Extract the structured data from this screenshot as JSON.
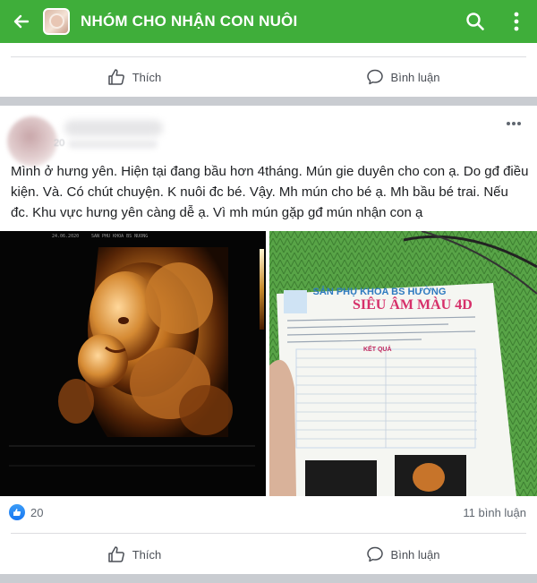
{
  "topbar": {
    "title": "NHÓM CHO NHẬN CON NUÔI",
    "back_icon": "arrow-left-icon",
    "search_icon": "search-icon",
    "more_icon": "vertical-ellipsis-icon",
    "color": "#3fae3a"
  },
  "prev_post": {
    "like_label": "Thích",
    "comment_label": "Bình luận"
  },
  "post": {
    "time_prefix": "20",
    "text": "Mình ở hưng yên. Hiện tại đang bầu hơn 4tháng. Mún gie duyên cho con ạ. Do gđ điều kiện. Và. Có chút chuyện. K nuôi đc bé. Vậy. Mh mún cho bé ạ. Mh bầu bé trai. Nếu đc. Khu vực hưng yên càng dễ ạ. Vì mh mún gặp gđ mún nhận con ạ",
    "ultrasound": {
      "date": "24.06.2020",
      "clinic": "SAN PHU KHOA BS NUONG"
    },
    "report": {
      "title": "SIÊU ÂM MÀU 4D",
      "clinic": "SẢN PHỤ KHOA BS HƯỜNG",
      "section": "KẾT QUẢ"
    },
    "reaction_count": "20",
    "comment_count": "11 bình luận",
    "like_label": "Thích",
    "comment_label": "Bình luận"
  }
}
